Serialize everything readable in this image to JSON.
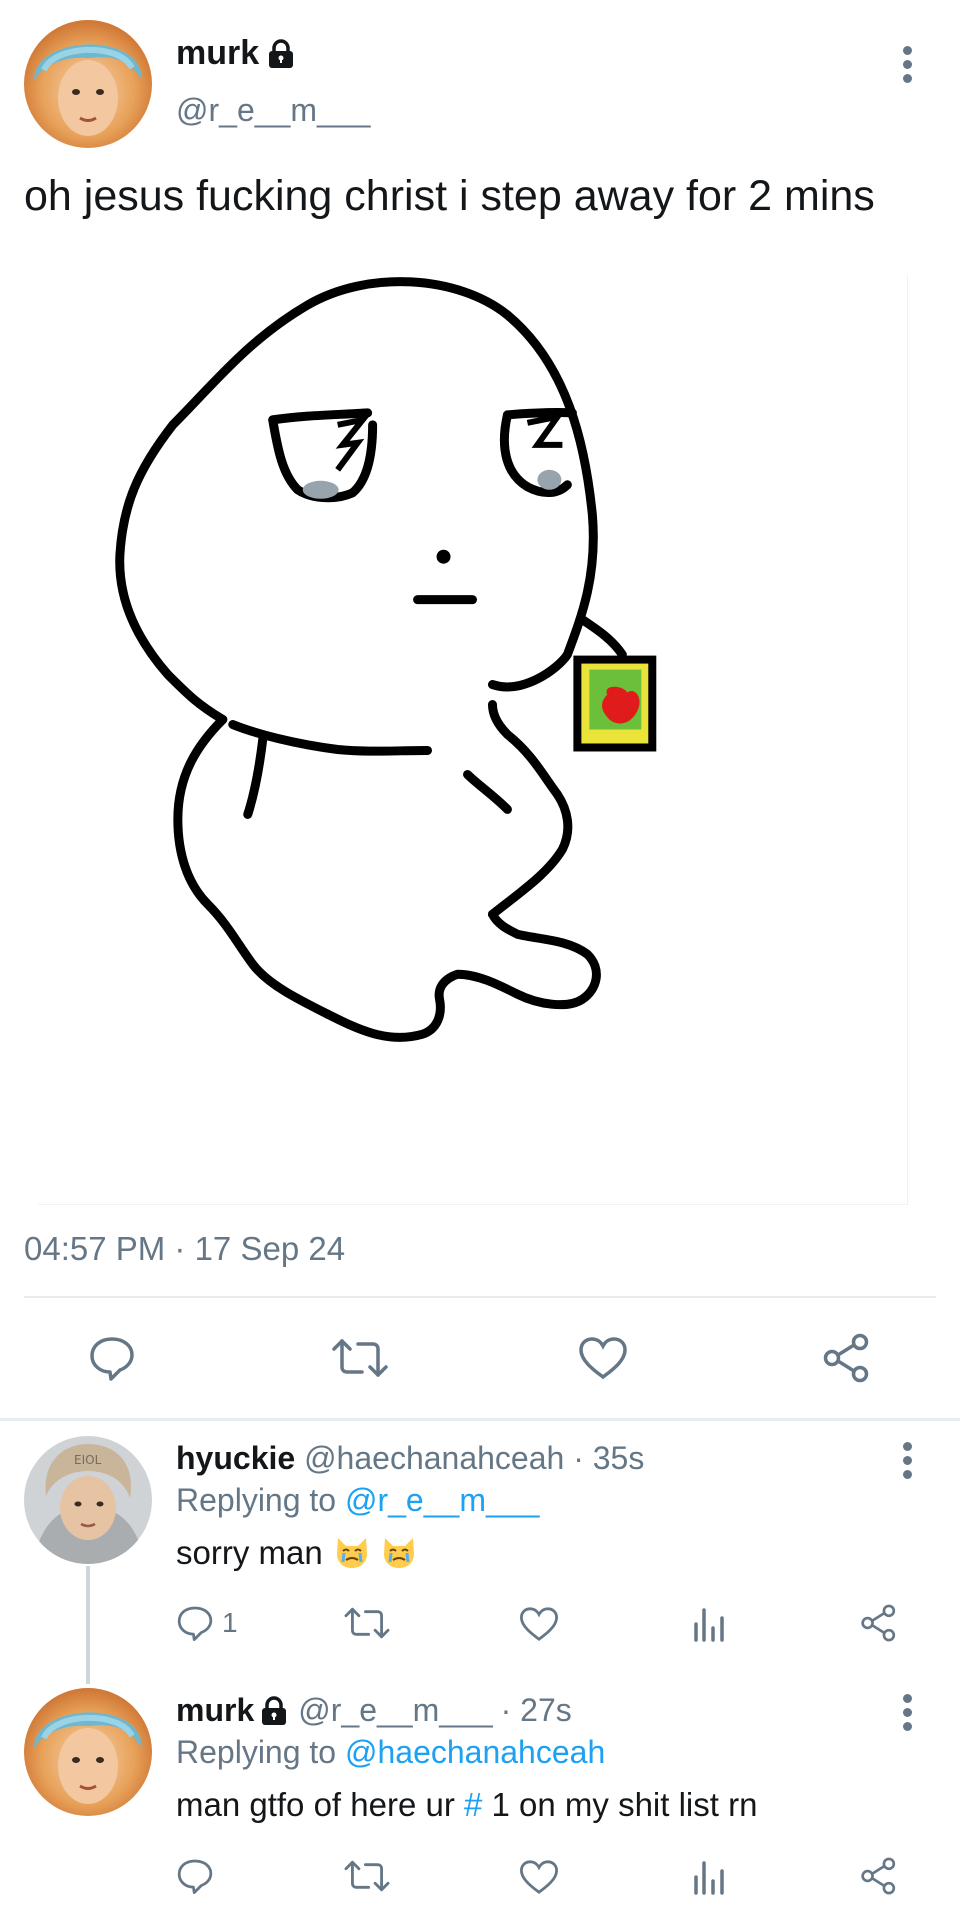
{
  "main_tweet": {
    "display_name": "murk",
    "handle": "@r_e__m___",
    "text": "oh jesus fucking christ i step away for 2 mins",
    "timestamp": "04:57 PM · 17 Sep 24",
    "media": {
      "icon": "doodle-character-with-juice-box"
    },
    "actions": [
      "reply-icon",
      "retweet-icon",
      "like-icon",
      "share-icon"
    ]
  },
  "replies": [
    {
      "display_name": "hyuckie",
      "handle": "@haechanahceah",
      "time": "· 35s",
      "replying_label": "Replying to",
      "replying_to": "@r_e__m___",
      "text": "sorry man",
      "emoji": "crying-cat-face",
      "reply_count": "1"
    },
    {
      "display_name": "murk",
      "handle": "@r_e__m___",
      "time": "· 27s",
      "replying_label": "Replying to",
      "replying_to": "@haechanahceah",
      "text_before": "man gtfo of here ur ",
      "hashtag": "#",
      "text_after": " 1 on my shit list rn",
      "reply_count": ""
    }
  ],
  "colors": {
    "primary_text": "#14171a",
    "secondary_text": "#657786",
    "link": "#1da1f2",
    "divider": "#e6ecf0"
  }
}
